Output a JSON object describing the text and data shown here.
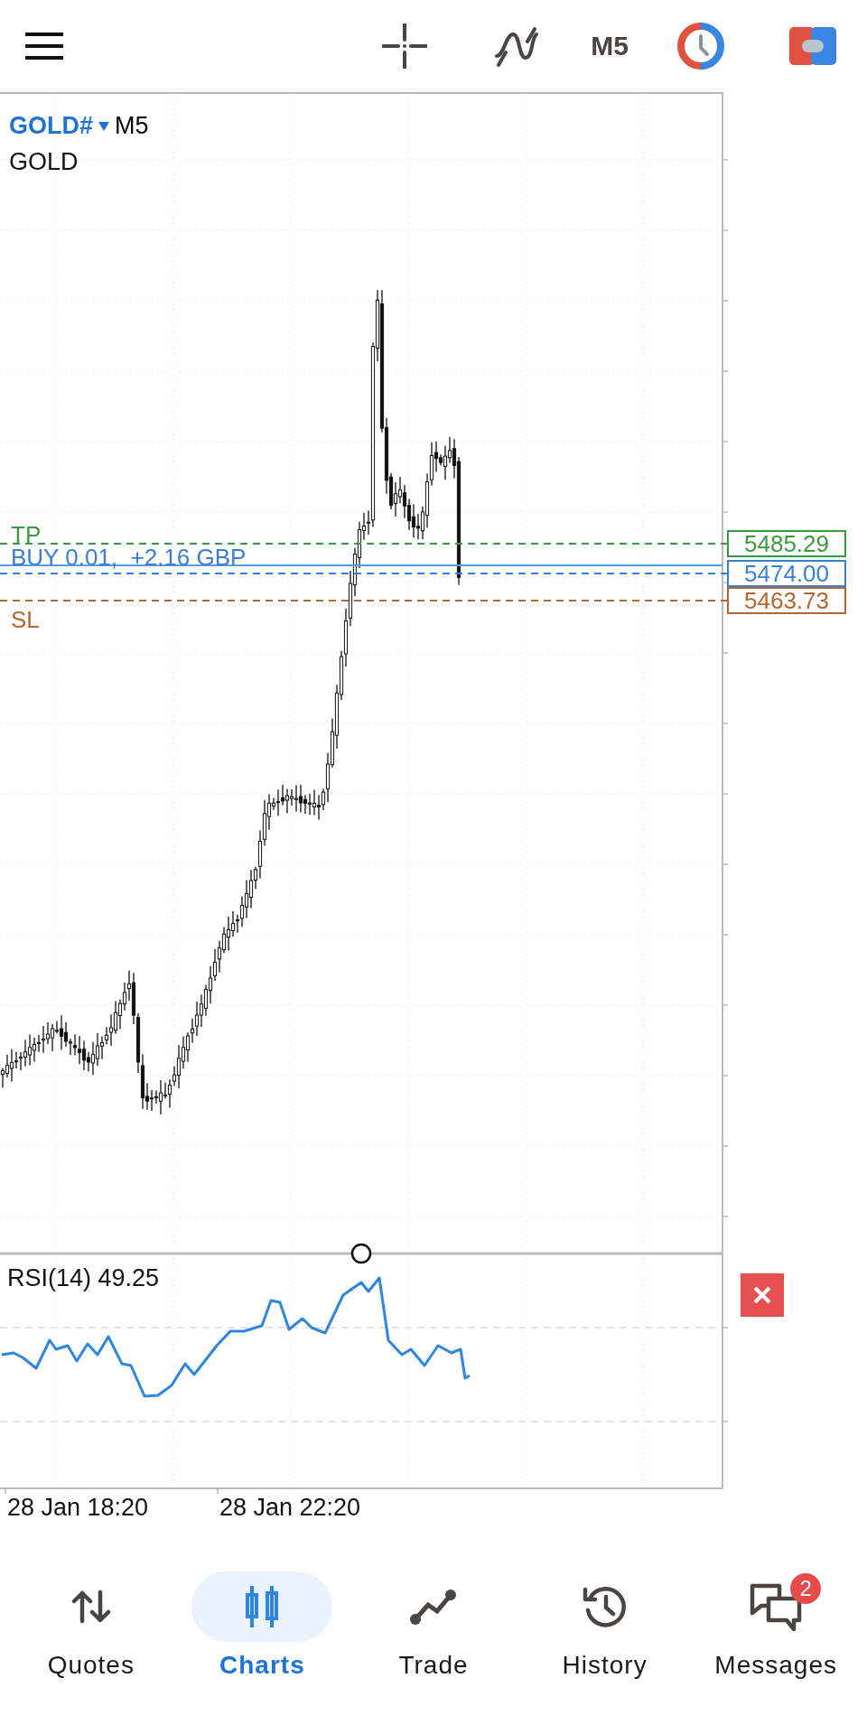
{
  "toolbar": {
    "timeframe": "M5"
  },
  "chart": {
    "symbol": "GOLD#",
    "timeframe": "M5",
    "description": "GOLD",
    "orders": [
      {
        "kind": "tp",
        "label": "TP",
        "price": "5485.29",
        "color": "#3b9a3f"
      },
      {
        "kind": "position",
        "label": "BUY 0.01,  +2.16 GBP",
        "price": "5474.00",
        "color": "#3a7fd6"
      },
      {
        "kind": "sl",
        "label": "SL",
        "price": "5463.73",
        "color": "#b8652f"
      }
    ],
    "indicator": {
      "label": "RSI(14) 49.25"
    },
    "time_labels": [
      "28 Jan 18:20",
      "28 Jan 22:20"
    ]
  },
  "nav": [
    {
      "label": "Quotes",
      "selected": false
    },
    {
      "label": "Charts",
      "selected": true
    },
    {
      "label": "Trade",
      "selected": false
    },
    {
      "label": "History",
      "selected": false
    },
    {
      "label": "Messages",
      "selected": false,
      "badge": "2"
    }
  ]
}
